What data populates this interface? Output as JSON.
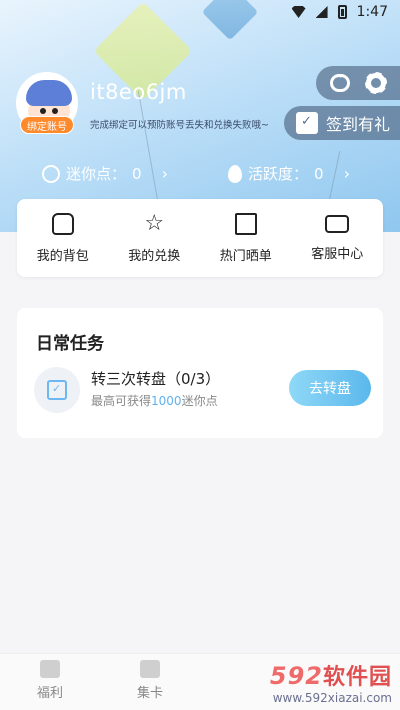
{
  "status_bar": {
    "time": "1:47"
  },
  "profile": {
    "username": "it8eo6jm",
    "bind_badge": "绑定账号",
    "bind_tip": "完成绑定可以预防账号丢失和兑换失败哦~"
  },
  "top_actions": {
    "signin_label": "签到有礼"
  },
  "stats": {
    "mini_points_label": "迷你点：",
    "mini_points_value": "0",
    "activity_label": "活跃度：",
    "activity_value": "0"
  },
  "quick_actions": [
    {
      "label": "我的背包",
      "icon": "backpack-icon"
    },
    {
      "label": "我的兑换",
      "icon": "star-icon"
    },
    {
      "label": "热门晒单",
      "icon": "box-icon"
    },
    {
      "label": "客服中心",
      "icon": "message-icon"
    }
  ],
  "daily_tasks": {
    "title": "日常任务",
    "items": [
      {
        "name": "转三次转盘（0/3）",
        "sub_prefix": "最高可获得",
        "sub_highlight": "1000",
        "sub_suffix": "迷你点",
        "button": "去转盘"
      }
    ]
  },
  "bottom_nav": [
    {
      "label": "福利",
      "icon": "store-icon"
    },
    {
      "label": "集卡",
      "icon": "card-box-icon"
    }
  ],
  "watermark": {
    "brand_num": "592",
    "brand_cn": "软件园",
    "url": "www.592xiazai.com"
  },
  "colors": {
    "accent": "#5bb8ec",
    "badge": "#ff8a2c",
    "highlight": "#5eb2f0"
  }
}
